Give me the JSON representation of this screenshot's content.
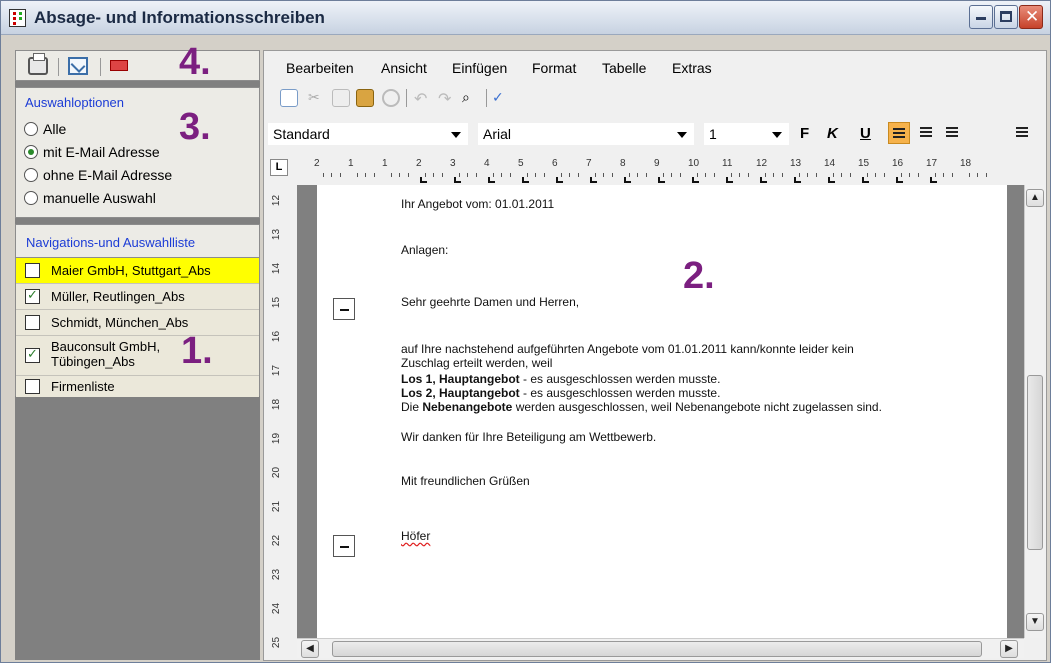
{
  "window": {
    "title": "Absage- und Informationsschreiben"
  },
  "left": {
    "toolbar_icons": [
      "printer-icon",
      "email-send-icon",
      "pdf-icon"
    ],
    "options": {
      "header": "Auswahloptionen",
      "items": [
        {
          "label": "Alle",
          "selected": false
        },
        {
          "label": "mit E-Mail Adresse",
          "selected": true
        },
        {
          "label": "ohne E-Mail Adresse",
          "selected": false
        },
        {
          "label": "manuelle Auswahl",
          "selected": false
        }
      ]
    },
    "nav": {
      "header": "Navigations-und Auswahlliste",
      "items": [
        {
          "label": "Maier GmbH, Stuttgart_Abs",
          "checked": false,
          "highlighted": true
        },
        {
          "label": "Müller, Reutlingen_Abs",
          "checked": true
        },
        {
          "label": "Schmidt, München_Abs",
          "checked": false
        },
        {
          "label_line1": "Bauconsult GmbH,",
          "label_line2": "Tübingen_Abs",
          "checked": true
        },
        {
          "label": "Firmenliste",
          "checked": false
        }
      ]
    }
  },
  "annotations": {
    "n1": "1.",
    "n2": "2.",
    "n3": "3.",
    "n4": "4."
  },
  "editor": {
    "menu": [
      "Bearbeiten",
      "Ansicht",
      "Einfügen",
      "Format",
      "Tabelle",
      "Extras"
    ],
    "style": "Standard",
    "font": "Arial",
    "size": "1",
    "format_buttons": {
      "bold": "F",
      "italic": "K",
      "underline": "U"
    },
    "ruler_h": [
      "2",
      "1",
      "1",
      "2",
      "3",
      "4",
      "5",
      "6",
      "7",
      "8",
      "9",
      "10",
      "11",
      "12",
      "13",
      "14",
      "15",
      "16",
      "17",
      "18"
    ],
    "ruler_v": [
      "12",
      "13",
      "14",
      "15",
      "16",
      "17",
      "18",
      "19",
      "20",
      "21",
      "22",
      "23",
      "24",
      "25"
    ],
    "document": {
      "line1": "Ihr Angebot vom:  01.01.2011",
      "line2": "Anlagen:",
      "greeting": "Sehr geehrte Damen und Herren,",
      "body1": "auf Ihre nachstehend aufgeführten Angebote vom 01.01.2011 kann/konnte leider kein",
      "body2": "Zuschlag erteilt werden, weil",
      "los1_bold": "Los 1, Hauptangebot",
      "los1_rest": " - es ausgeschlossen werden musste.",
      "los2_bold": "Los 2, Hauptangebot",
      "los2_rest": " - es ausgeschlossen werden musste.",
      "neben_pre": "Die ",
      "neben_bold": "Nebenangebote",
      "neben_rest": " werden ausgeschlossen, weil Nebenangebote nicht zugelassen sind.",
      "thanks": "Wir danken für Ihre Beteiligung am Wettbewerb.",
      "closing": "Mit freundlichen Grüßen",
      "signature": "Höfer"
    }
  }
}
